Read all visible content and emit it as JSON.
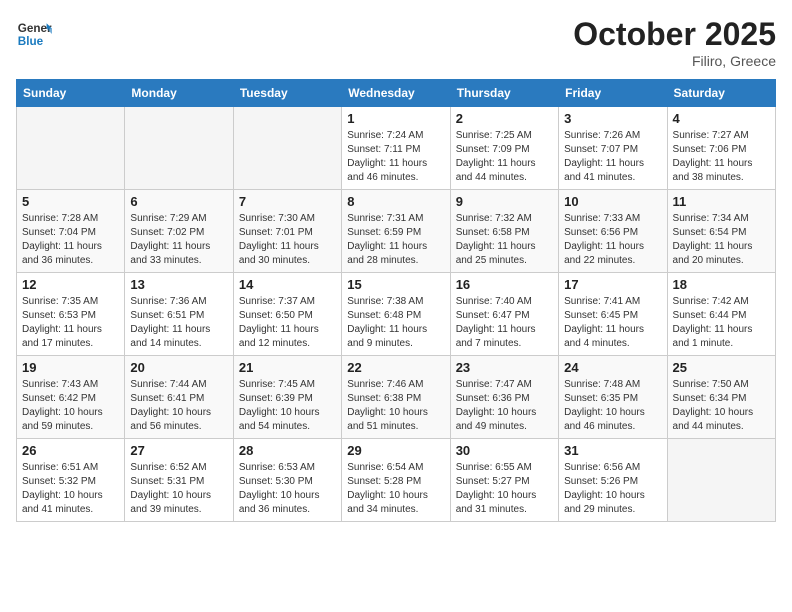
{
  "header": {
    "logo_line1": "General",
    "logo_line2": "Blue",
    "month_title": "October 2025",
    "location": "Filiro, Greece"
  },
  "days_of_week": [
    "Sunday",
    "Monday",
    "Tuesday",
    "Wednesday",
    "Thursday",
    "Friday",
    "Saturday"
  ],
  "weeks": [
    [
      {
        "day": "",
        "info": ""
      },
      {
        "day": "",
        "info": ""
      },
      {
        "day": "",
        "info": ""
      },
      {
        "day": "1",
        "info": "Sunrise: 7:24 AM\nSunset: 7:11 PM\nDaylight: 11 hours and 46 minutes."
      },
      {
        "day": "2",
        "info": "Sunrise: 7:25 AM\nSunset: 7:09 PM\nDaylight: 11 hours and 44 minutes."
      },
      {
        "day": "3",
        "info": "Sunrise: 7:26 AM\nSunset: 7:07 PM\nDaylight: 11 hours and 41 minutes."
      },
      {
        "day": "4",
        "info": "Sunrise: 7:27 AM\nSunset: 7:06 PM\nDaylight: 11 hours and 38 minutes."
      }
    ],
    [
      {
        "day": "5",
        "info": "Sunrise: 7:28 AM\nSunset: 7:04 PM\nDaylight: 11 hours and 36 minutes."
      },
      {
        "day": "6",
        "info": "Sunrise: 7:29 AM\nSunset: 7:02 PM\nDaylight: 11 hours and 33 minutes."
      },
      {
        "day": "7",
        "info": "Sunrise: 7:30 AM\nSunset: 7:01 PM\nDaylight: 11 hours and 30 minutes."
      },
      {
        "day": "8",
        "info": "Sunrise: 7:31 AM\nSunset: 6:59 PM\nDaylight: 11 hours and 28 minutes."
      },
      {
        "day": "9",
        "info": "Sunrise: 7:32 AM\nSunset: 6:58 PM\nDaylight: 11 hours and 25 minutes."
      },
      {
        "day": "10",
        "info": "Sunrise: 7:33 AM\nSunset: 6:56 PM\nDaylight: 11 hours and 22 minutes."
      },
      {
        "day": "11",
        "info": "Sunrise: 7:34 AM\nSunset: 6:54 PM\nDaylight: 11 hours and 20 minutes."
      }
    ],
    [
      {
        "day": "12",
        "info": "Sunrise: 7:35 AM\nSunset: 6:53 PM\nDaylight: 11 hours and 17 minutes."
      },
      {
        "day": "13",
        "info": "Sunrise: 7:36 AM\nSunset: 6:51 PM\nDaylight: 11 hours and 14 minutes."
      },
      {
        "day": "14",
        "info": "Sunrise: 7:37 AM\nSunset: 6:50 PM\nDaylight: 11 hours and 12 minutes."
      },
      {
        "day": "15",
        "info": "Sunrise: 7:38 AM\nSunset: 6:48 PM\nDaylight: 11 hours and 9 minutes."
      },
      {
        "day": "16",
        "info": "Sunrise: 7:40 AM\nSunset: 6:47 PM\nDaylight: 11 hours and 7 minutes."
      },
      {
        "day": "17",
        "info": "Sunrise: 7:41 AM\nSunset: 6:45 PM\nDaylight: 11 hours and 4 minutes."
      },
      {
        "day": "18",
        "info": "Sunrise: 7:42 AM\nSunset: 6:44 PM\nDaylight: 11 hours and 1 minute."
      }
    ],
    [
      {
        "day": "19",
        "info": "Sunrise: 7:43 AM\nSunset: 6:42 PM\nDaylight: 10 hours and 59 minutes."
      },
      {
        "day": "20",
        "info": "Sunrise: 7:44 AM\nSunset: 6:41 PM\nDaylight: 10 hours and 56 minutes."
      },
      {
        "day": "21",
        "info": "Sunrise: 7:45 AM\nSunset: 6:39 PM\nDaylight: 10 hours and 54 minutes."
      },
      {
        "day": "22",
        "info": "Sunrise: 7:46 AM\nSunset: 6:38 PM\nDaylight: 10 hours and 51 minutes."
      },
      {
        "day": "23",
        "info": "Sunrise: 7:47 AM\nSunset: 6:36 PM\nDaylight: 10 hours and 49 minutes."
      },
      {
        "day": "24",
        "info": "Sunrise: 7:48 AM\nSunset: 6:35 PM\nDaylight: 10 hours and 46 minutes."
      },
      {
        "day": "25",
        "info": "Sunrise: 7:50 AM\nSunset: 6:34 PM\nDaylight: 10 hours and 44 minutes."
      }
    ],
    [
      {
        "day": "26",
        "info": "Sunrise: 6:51 AM\nSunset: 5:32 PM\nDaylight: 10 hours and 41 minutes."
      },
      {
        "day": "27",
        "info": "Sunrise: 6:52 AM\nSunset: 5:31 PM\nDaylight: 10 hours and 39 minutes."
      },
      {
        "day": "28",
        "info": "Sunrise: 6:53 AM\nSunset: 5:30 PM\nDaylight: 10 hours and 36 minutes."
      },
      {
        "day": "29",
        "info": "Sunrise: 6:54 AM\nSunset: 5:28 PM\nDaylight: 10 hours and 34 minutes."
      },
      {
        "day": "30",
        "info": "Sunrise: 6:55 AM\nSunset: 5:27 PM\nDaylight: 10 hours and 31 minutes."
      },
      {
        "day": "31",
        "info": "Sunrise: 6:56 AM\nSunset: 5:26 PM\nDaylight: 10 hours and 29 minutes."
      },
      {
        "day": "",
        "info": ""
      }
    ]
  ]
}
